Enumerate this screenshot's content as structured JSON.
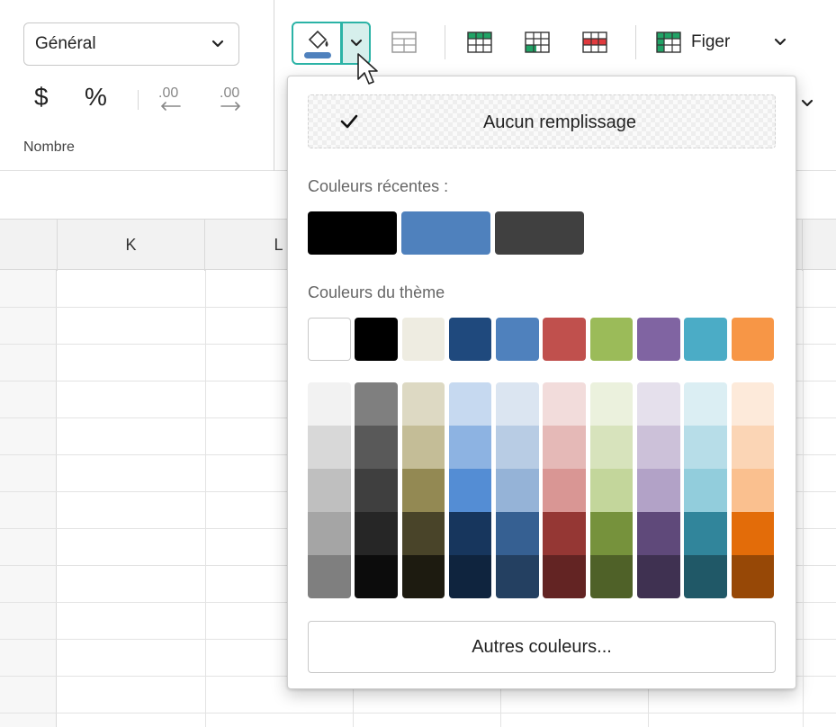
{
  "ribbon": {
    "number_format": "Général",
    "currency_symbol": "$",
    "percent_symbol": "%",
    "group_label": "Nombre",
    "freeze_label": "Figer"
  },
  "sheet": {
    "columns": [
      "K",
      "L"
    ]
  },
  "fill_popup": {
    "no_fill_label": "Aucun remplissage",
    "recent_label": "Couleurs récentes :",
    "recent_colors": [
      "#000000",
      "#4f81bd",
      "#404040"
    ],
    "theme_label": "Couleurs du thème",
    "theme_colors": [
      "#ffffff",
      "#000000",
      "#eeece1",
      "#1f497d",
      "#4f81bd",
      "#c0504d",
      "#9bbb59",
      "#8064a2",
      "#4bacc6",
      "#f79646"
    ],
    "shades": [
      [
        "#f2f2f2",
        "#d8d8d8",
        "#bfbfbf",
        "#a5a5a5",
        "#7f7f7f"
      ],
      [
        "#7f7f7f",
        "#595959",
        "#3f3f3f",
        "#262626",
        "#0c0c0c"
      ],
      [
        "#ddd9c3",
        "#c4bd97",
        "#938953",
        "#494429",
        "#1d1b10"
      ],
      [
        "#c6d9f0",
        "#8db3e2",
        "#548dd4",
        "#17365d",
        "#0f243e"
      ],
      [
        "#dbe5f1",
        "#b8cce4",
        "#95b3d7",
        "#366092",
        "#244061"
      ],
      [
        "#f2dcdb",
        "#e5b9b7",
        "#d99694",
        "#953734",
        "#632423"
      ],
      [
        "#ebf1dd",
        "#d7e3bc",
        "#c3d69b",
        "#76923c",
        "#4f6128"
      ],
      [
        "#e5e0ec",
        "#ccc1d9",
        "#b2a2c7",
        "#5f497a",
        "#3f3151"
      ],
      [
        "#dbeef3",
        "#b7dde8",
        "#92cddc",
        "#31859b",
        "#205867"
      ],
      [
        "#fdeada",
        "#fbd5b5",
        "#fac08f",
        "#e36c09",
        "#974806"
      ]
    ],
    "more_colors_label": "Autres couleurs..."
  }
}
